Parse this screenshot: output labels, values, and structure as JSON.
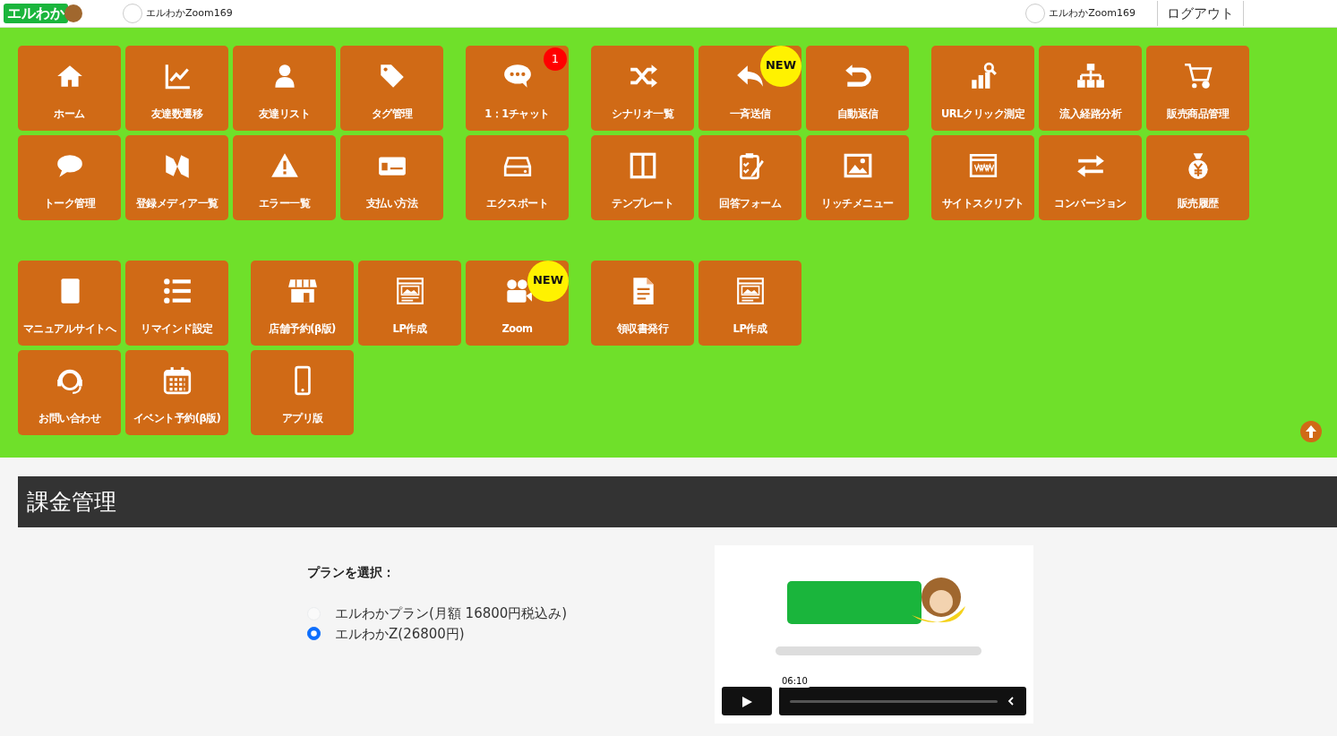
{
  "header": {
    "logo": "エルわか",
    "account_left": "エルわかZoom169",
    "account_right": "エルわかZoom169",
    "logout": "ログアウト"
  },
  "menu_sections": [
    {
      "groups": [
        {
          "rows": [
            [
              {
                "label": "ホーム"
              },
              {
                "label": "友達数遷移"
              },
              {
                "label": "友達リスト"
              },
              {
                "label": "タグ管理"
              }
            ],
            [
              {
                "label": "トーク管理"
              },
              {
                "label": "登録メディア一覧"
              },
              {
                "label": "エラー一覧"
              },
              {
                "label": "支払い方法"
              }
            ]
          ]
        },
        {
          "rows": [
            [
              {
                "label": "1：1チャット",
                "badge": {
                  "kind": "count",
                  "text": "1"
                }
              }
            ],
            [
              {
                "label": "エクスポート"
              }
            ]
          ]
        },
        {
          "rows": [
            [
              {
                "label": "シナリオ一覧"
              },
              {
                "label": "一斉送信",
                "badge": {
                  "kind": "new",
                  "text": "NEW"
                }
              },
              {
                "label": "自動返信"
              }
            ],
            [
              {
                "label": "テンプレート"
              },
              {
                "label": "回答フォーム"
              },
              {
                "label": "リッチメニュー"
              }
            ]
          ]
        },
        {
          "rows": [
            [
              {
                "label": "URLクリック測定"
              },
              {
                "label": "流入経路分析"
              },
              {
                "label": "販売商品管理"
              }
            ],
            [
              {
                "label": "サイトスクリプト"
              },
              {
                "label": "コンバージョン"
              },
              {
                "label": "販売履歴"
              }
            ]
          ]
        }
      ]
    },
    {
      "groups": [
        {
          "rows": [
            [
              {
                "label": "マニュアルサイトへ"
              },
              {
                "label": "リマインド設定"
              }
            ],
            [
              {
                "label": "お問い合わせ"
              },
              {
                "label": "イベント予約(β版)"
              }
            ]
          ]
        },
        {
          "rows": [
            [
              {
                "label": "店舗予約(β版)"
              },
              {
                "label": "LP作成"
              },
              {
                "label": "Zoom",
                "badge": {
                  "kind": "new",
                  "text": "NEW"
                }
              }
            ],
            [
              {
                "label": "アプリ版"
              }
            ]
          ]
        },
        {
          "rows": [
            [
              {
                "label": "領収書発行"
              },
              {
                "label": "LP作成"
              }
            ]
          ]
        }
      ]
    }
  ],
  "page_title": "課金管理",
  "plan": {
    "label": "プランを選択：",
    "options": [
      {
        "label": "エルわかプラン(月額 16800円税込み)",
        "selected": false
      },
      {
        "label": "エルわかZ(26800円)",
        "selected": true
      }
    ]
  },
  "video": {
    "time": "06:10",
    "level": 0
  }
}
